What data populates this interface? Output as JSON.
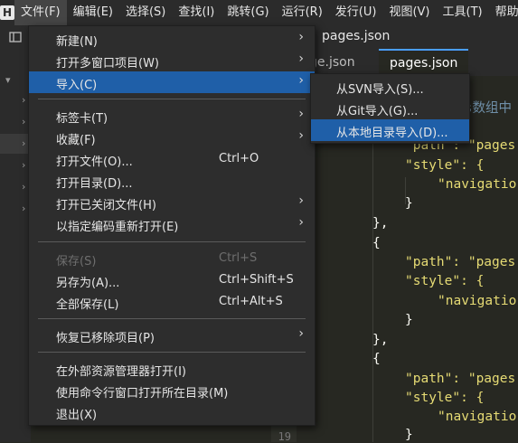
{
  "menubar": {
    "logo_text": "H",
    "items": [
      "文件(F)",
      "编辑(E)",
      "选择(S)",
      "查找(I)",
      "跳转(G)",
      "运行(R)",
      "发行(U)",
      "视图(V)",
      "工具(T)",
      "帮助(Y)"
    ]
  },
  "toolbar": {
    "title": "pages.json"
  },
  "tabs": [
    {
      "label": "ge.json"
    },
    {
      "label": "pages.json"
    }
  ],
  "editor": {
    "line_number": "19",
    "lines": [
      {
        "text": "es数组中"
      },
      {
        "text": "\"path\": \"pages"
      },
      {
        "text": "\"style\": {"
      },
      {
        "text": "\"navigatio"
      },
      {
        "text": "}"
      },
      {
        "text": "},"
      },
      {
        "text": "{"
      },
      {
        "text": "\"path\": \"pages"
      },
      {
        "text": "\"style\": {"
      },
      {
        "text": "\"navigatio"
      },
      {
        "text": "}"
      },
      {
        "text": "},"
      },
      {
        "text": "{"
      },
      {
        "text": "\"path\": \"pages"
      },
      {
        "text": "\"style\": {"
      },
      {
        "text": "\"navigatio"
      },
      {
        "text": "}"
      }
    ]
  },
  "file_menu": {
    "items": [
      {
        "label": "新建(N)",
        "shortcut": "",
        "submenu": true
      },
      {
        "label": "打开多窗口项目(W)",
        "shortcut": "",
        "submenu": true
      },
      {
        "label": "导入(C)",
        "shortcut": "",
        "submenu": true
      },
      {
        "label": "标签卡(T)",
        "shortcut": "",
        "submenu": true
      },
      {
        "label": "收藏(F)",
        "shortcut": "",
        "submenu": true
      },
      {
        "label": "打开文件(O)...",
        "shortcut": "Ctrl+O",
        "submenu": false
      },
      {
        "label": "打开目录(D)...",
        "shortcut": "",
        "submenu": false
      },
      {
        "label": "打开已关闭文件(H)",
        "shortcut": "",
        "submenu": true
      },
      {
        "label": "以指定编码重新打开(E)",
        "shortcut": "",
        "submenu": true
      },
      {
        "label": "保存(S)",
        "shortcut": "Ctrl+S",
        "submenu": false,
        "disabled": true
      },
      {
        "label": "另存为(A)...",
        "shortcut": "Ctrl+Shift+S",
        "submenu": false
      },
      {
        "label": "全部保存(L)",
        "shortcut": "Ctrl+Alt+S",
        "submenu": false
      },
      {
        "label": "恢复已移除项目(P)",
        "shortcut": "",
        "submenu": true
      },
      {
        "label": "在外部资源管理器打开(I)",
        "shortcut": "",
        "submenu": false
      },
      {
        "label": "使用命令行窗口打开所在目录(M)",
        "shortcut": "",
        "submenu": false
      },
      {
        "label": "退出(X)",
        "shortcut": "",
        "submenu": false
      }
    ]
  },
  "import_submenu": {
    "items": [
      {
        "label": "从SVN导入(S)..."
      },
      {
        "label": "从Git导入(G)..."
      },
      {
        "label": "从本地目录导入(D)..."
      }
    ]
  },
  "colors": {
    "highlight": "#1f5fa8",
    "json_key": "#e6db74",
    "background": "#272822"
  }
}
